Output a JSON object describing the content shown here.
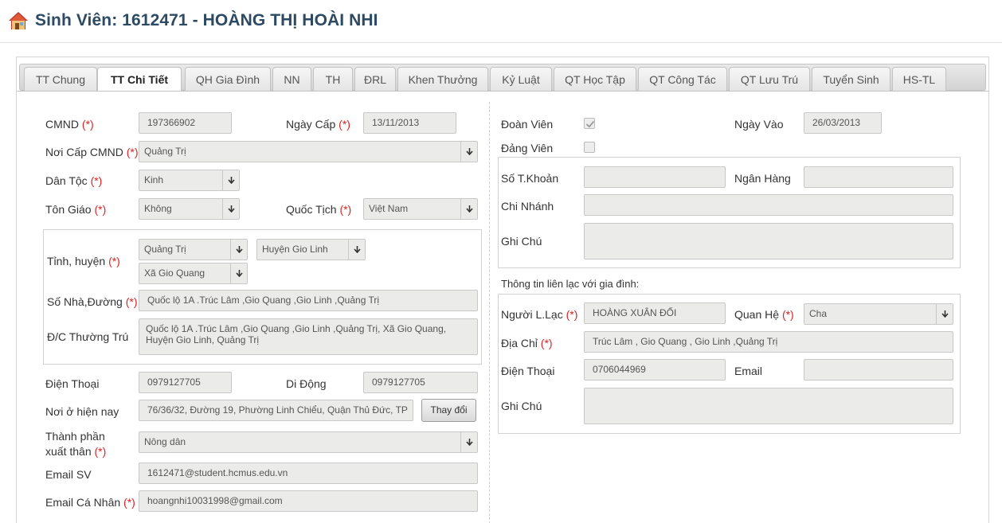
{
  "header": {
    "title": "Sinh Viên: 1612471 - HOÀNG THỊ HOÀI NHI",
    "icon": "home-icon"
  },
  "tabs": [
    {
      "label": "TT Chung",
      "active": false
    },
    {
      "label": "TT Chi Tiết",
      "active": true
    },
    {
      "label": "QH Gia Đình",
      "active": false
    },
    {
      "label": "NN",
      "active": false
    },
    {
      "label": "TH",
      "active": false
    },
    {
      "label": "ĐRL",
      "active": false
    },
    {
      "label": "Khen Thưởng",
      "active": false
    },
    {
      "label": "Kỷ Luật",
      "active": false
    },
    {
      "label": "QT Học Tập",
      "active": false
    },
    {
      "label": "QT Công Tác",
      "active": false
    },
    {
      "label": "QT Lưu Trú",
      "active": false
    },
    {
      "label": "Tuyển Sinh",
      "active": false
    },
    {
      "label": "HS-TL",
      "active": false
    }
  ],
  "required_mark": "(*)",
  "left": {
    "cmnd": {
      "label": "CMND",
      "value": "197366902"
    },
    "ngay_cap": {
      "label": "Ngày Cấp",
      "value": "13/11/2013"
    },
    "noi_cap": {
      "label": "Nơi Cấp CMND",
      "value": "Quảng Trị"
    },
    "dan_toc": {
      "label": "Dân Tộc",
      "value": "Kinh"
    },
    "ton_giao": {
      "label": "Tôn Giáo",
      "value": "Không"
    },
    "quoc_tich": {
      "label": "Quốc Tịch",
      "value": "Việt Nam"
    },
    "tinh_huyen": {
      "label": "Tỉnh, huyện",
      "tinh": "Quảng Trị",
      "huyen": "Huyện Gio Linh",
      "xa": "Xã Gio Quang"
    },
    "so_nha": {
      "label": "Số Nhà,Đường",
      "value": "Quốc lộ 1A .Trúc Lâm ,Gio Quang ,Gio Linh ,Quảng Trị"
    },
    "thuong_tru": {
      "label": "Đ/C Thường Trú",
      "value": "Quốc lộ 1A .Trúc Lâm ,Gio Quang ,Gio Linh ,Quảng Trị, Xã Gio Quang, Huyện Gio Linh, Quảng Trị"
    },
    "dien_thoai": {
      "label": "Điện Thoại",
      "value": "0979127705"
    },
    "di_dong": {
      "label": "Di Động",
      "value": "0979127705"
    },
    "noi_o": {
      "label": "Nơi ở hiện nay",
      "value": "76/36/32, Đường 19, Phường Linh Chiểu, Quận Thủ Đức, TP",
      "button": "Thay đổi"
    },
    "thanh_phan": {
      "label_line1": "Thành phần",
      "label_line2": "xuất thân",
      "value": "Nông dân"
    },
    "email_sv": {
      "label": "Email SV",
      "value": "1612471@student.hcmus.edu.vn"
    },
    "email_cn": {
      "label": "Email Cá Nhân",
      "value": "hoangnhi10031998@gmail.com"
    }
  },
  "right": {
    "doan_vien": {
      "label": "Đoàn Viên",
      "checked": true
    },
    "ngay_vao": {
      "label": "Ngày Vào",
      "value": "26/03/2013"
    },
    "dang_vien": {
      "label": "Đảng Viên",
      "checked": false
    },
    "so_tk": {
      "label": "Số T.Khoản",
      "value": ""
    },
    "ngan_hang": {
      "label": "Ngân Hàng",
      "value": ""
    },
    "chi_nhanh": {
      "label": "Chi Nhánh",
      "value": ""
    },
    "ghi_chu": {
      "label": "Ghi Chú",
      "value": ""
    },
    "family_heading": "Thông tin liên lạc với gia đình:",
    "nguoi_ll": {
      "label": "Người L.Lạc",
      "value": "HOÀNG XUÂN ĐỐI"
    },
    "quan_he": {
      "label": "Quan Hệ",
      "value": "Cha"
    },
    "dia_chi": {
      "label": "Địa Chỉ",
      "value": "Trúc Lâm , Gio Quang , Gio Linh ,Quảng Trị"
    },
    "dien_thoai": {
      "label": "Điện Thoại",
      "value": "0706044969"
    },
    "email": {
      "label": "Email",
      "value": ""
    },
    "ghi_chu2": {
      "label": "Ghi Chú",
      "value": ""
    }
  }
}
